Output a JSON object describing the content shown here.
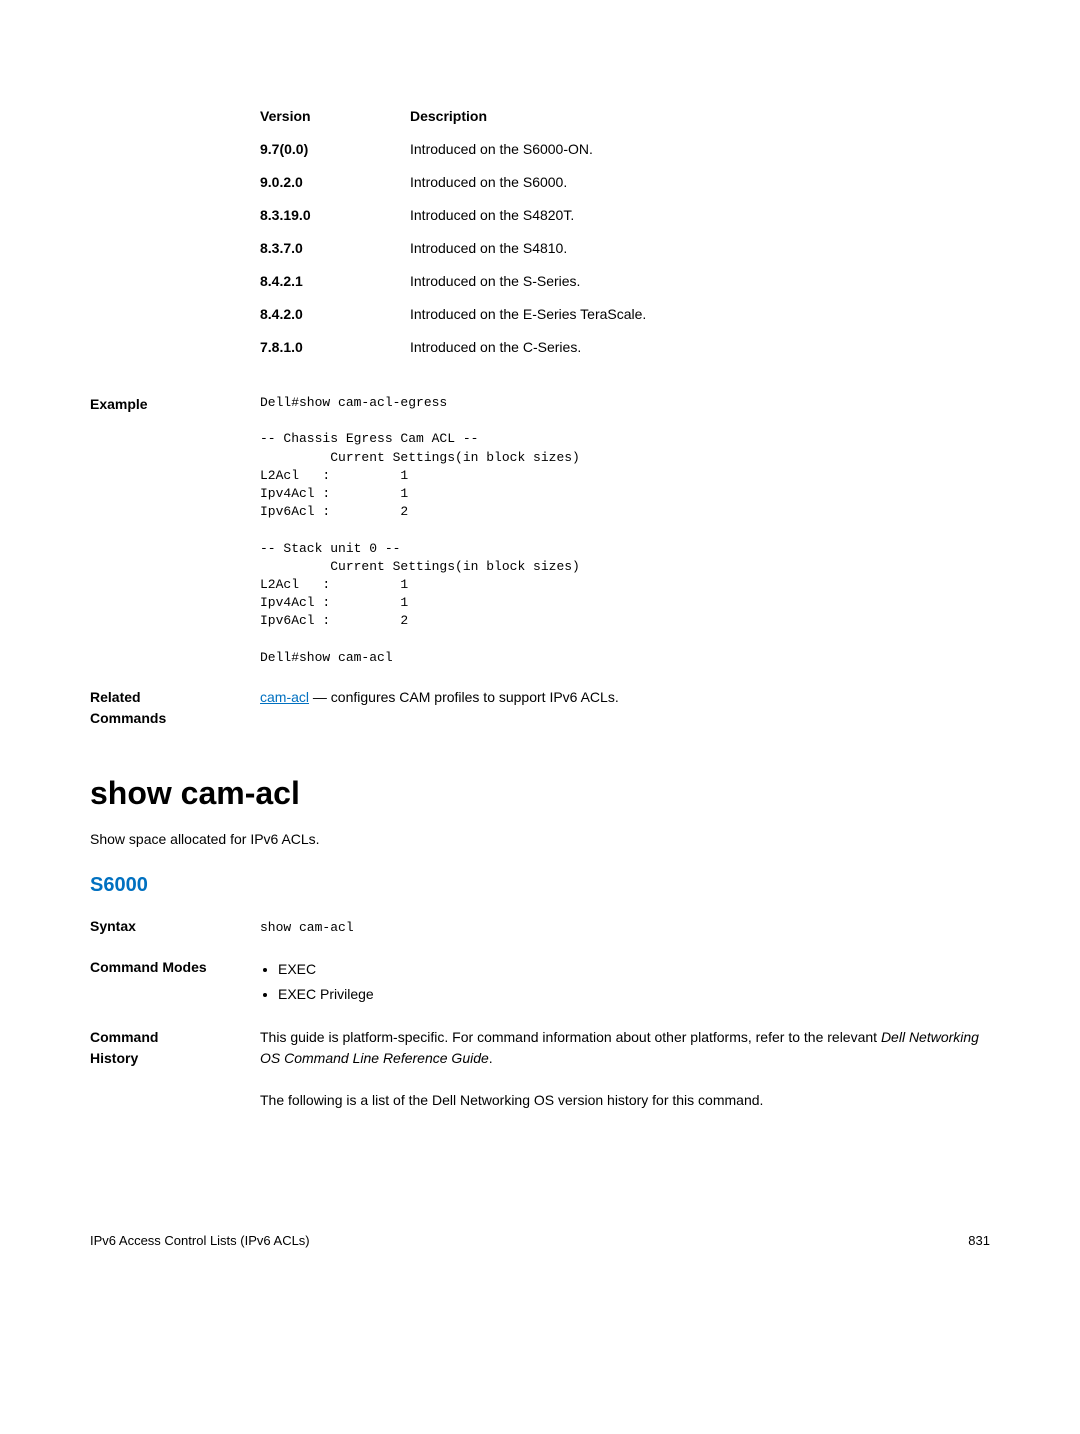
{
  "version_table": {
    "headers": {
      "version": "Version",
      "description": "Description"
    },
    "rows": [
      {
        "version": "9.7(0.0)",
        "description": "Introduced on the S6000-ON."
      },
      {
        "version": "9.0.2.0",
        "description": "Introduced on the S6000."
      },
      {
        "version": "8.3.19.0",
        "description": "Introduced on the S4820T."
      },
      {
        "version": "8.3.7.0",
        "description": "Introduced on the S4810."
      },
      {
        "version": "8.4.2.1",
        "description": "Introduced on the S-Series."
      },
      {
        "version": "8.4.2.0",
        "description": "Introduced on the E-Series TeraScale."
      },
      {
        "version": "7.8.1.0",
        "description": "Introduced on the C-Series."
      }
    ]
  },
  "example": {
    "label": "Example",
    "code": "Dell#show cam-acl-egress\n\n-- Chassis Egress Cam ACL --\n         Current Settings(in block sizes)\nL2Acl   :         1\nIpv4Acl :         1\nIpv6Acl :         2\n\n-- Stack unit 0 --\n         Current Settings(in block sizes)\nL2Acl   :         1\nIpv4Acl :         1\nIpv6Acl :         2\n\nDell#show cam-acl"
  },
  "related": {
    "label": "Related Commands",
    "link_text": "cam-acl",
    "suffix": " — configures CAM profiles to support IPv6 ACLs."
  },
  "heading": "show cam-acl",
  "subtitle": "Show space allocated for IPv6 ACLs.",
  "platform": "S6000",
  "syntax": {
    "label": "Syntax",
    "value": "show cam-acl"
  },
  "command_modes": {
    "label": "Command Modes",
    "items": [
      "EXEC",
      "EXEC Privilege"
    ]
  },
  "command_history": {
    "label": "Command History",
    "p1_prefix": "This guide is platform-specific. For command information about other platforms, refer to the relevant ",
    "p1_italic": "Dell Networking OS Command Line Reference Guide",
    "p1_suffix": ".",
    "p2": "The following is a list of the Dell Networking OS version history for this command."
  },
  "footer": {
    "left": "IPv6 Access Control Lists (IPv6 ACLs)",
    "right": "831"
  }
}
